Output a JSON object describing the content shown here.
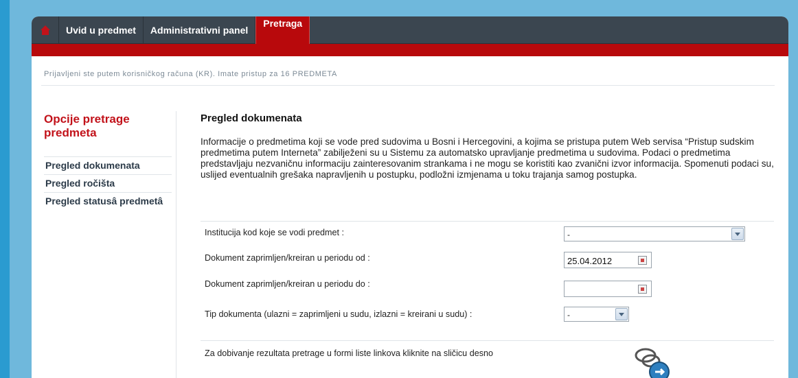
{
  "nav": {
    "home_icon": "home-icon",
    "items": [
      "Uvid u predmet",
      "Administrativni panel"
    ],
    "active": "Pretraga"
  },
  "login_info": "Prijavljeni ste putem korisničkog računa (KR). Imate pristup za 16 PREDMETA",
  "sidebar": {
    "title": "Opcije pretrage predmeta",
    "links": [
      "Pregled dokumenata",
      "Pregled ročišta",
      "Pregled statusâ predmetâ"
    ]
  },
  "main": {
    "title": "Pregled dokumenata",
    "description": "Informacije o predmetima koji se vode pred sudovima u Bosni i Hercegovini, a kojima se pristupa putem Web servisa “Pristup sudskim predmetima putem Interneta” zabilježeni su u Sistemu za automatsko upravljanje predmetima u sudovima. Podaci o predmetima predstavljaju nezvaničnu informaciju zainteresovanim strankama i ne mogu se koristiti kao zvanični izvor informacija. Spomenuti podaci su, uslijed eventualnih grešaka napravljenih u postupku, podložni izmjenama u toku trajanja samog postupka."
  },
  "form": {
    "institution_label": "Institucija kod koje se vodi predmet :",
    "institution_value": "-",
    "date_from_label": "Dokument zaprimljen/kreiran u periodu od :",
    "date_from_value": "25.04.2012",
    "date_to_label": "Dokument zaprimljen/kreiran u periodu do :",
    "date_to_value": "",
    "doc_type_label": "Tip dokumenta (ulazni = zaprimljeni u sudu, izlazni = kreirani u sudu) :",
    "doc_type_value": "-",
    "hint": "Za dobivanje rezultata pretrage u formi liste linkova kliknite na sličicu desno"
  },
  "colors": {
    "accent": "#b8090c",
    "nav": "#3b4650",
    "title_red": "#c2121a"
  }
}
